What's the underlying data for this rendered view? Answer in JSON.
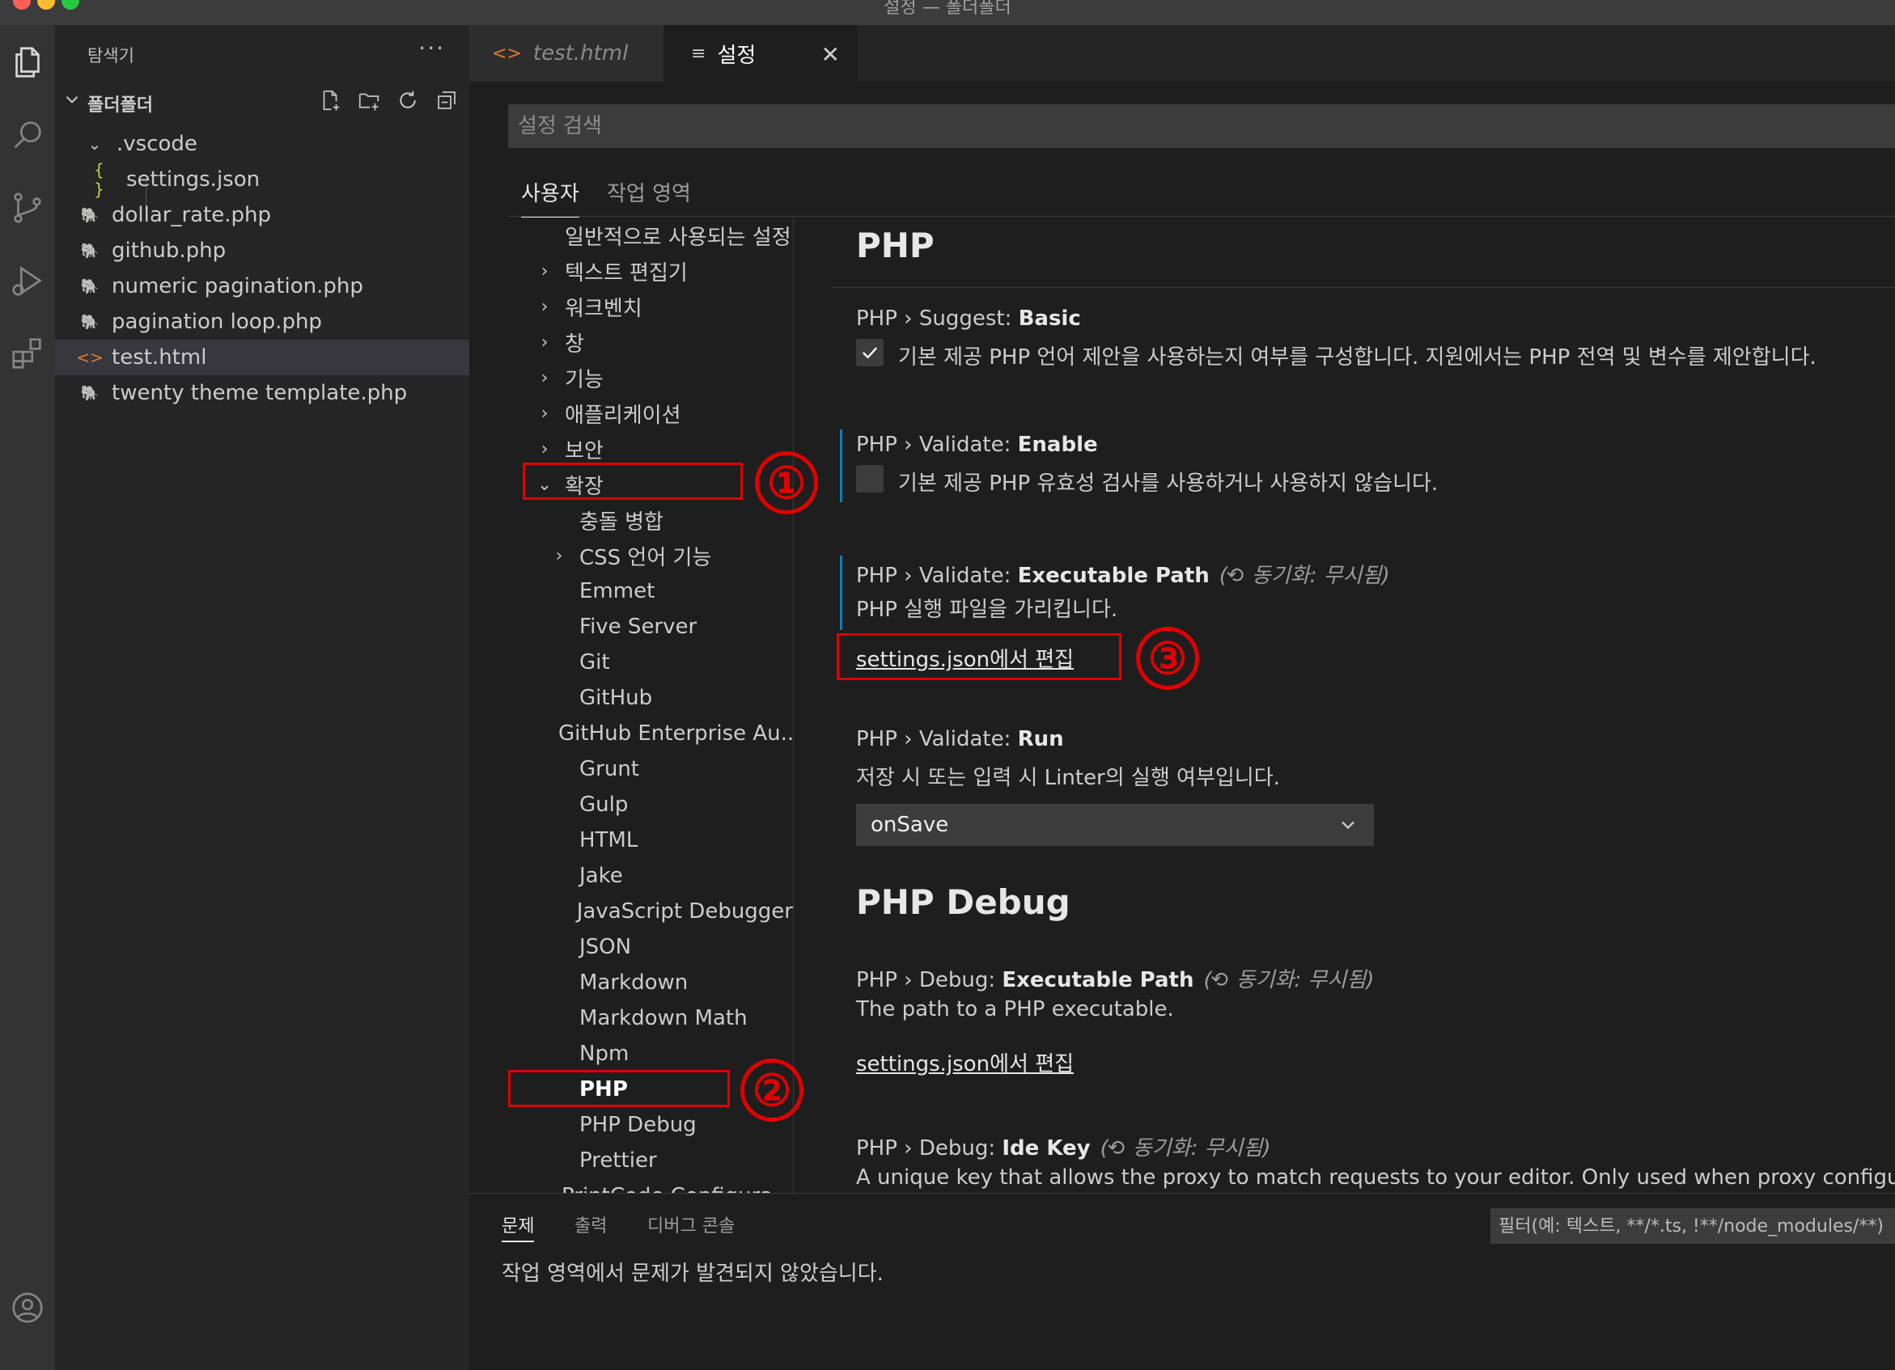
{
  "window": {
    "title": "설정 — 폴더폴더",
    "traffic_colors": [
      "#ff5f57",
      "#febc2e",
      "#28c840"
    ]
  },
  "activity_bar": {
    "icons": [
      "files-icon",
      "search-icon",
      "source-control-icon",
      "run-debug-icon",
      "extensions-icon",
      "account-icon"
    ]
  },
  "sidebar": {
    "header": "탐색기",
    "more": "···",
    "folder_name": "폴더폴더",
    "tree": [
      {
        "label": ".vscode",
        "type": "folder"
      },
      {
        "label": "settings.json",
        "type": "json",
        "icon": "{ }"
      },
      {
        "label": "dollar_rate.php",
        "type": "php"
      },
      {
        "label": "github.php",
        "type": "php"
      },
      {
        "label": "numeric pagination.php",
        "type": "php"
      },
      {
        "label": "pagination loop.php",
        "type": "php"
      },
      {
        "label": "test.html",
        "type": "html",
        "icon": "<>"
      },
      {
        "label": "twenty theme template.php",
        "type": "php"
      }
    ]
  },
  "tabs": [
    {
      "label": "test.html",
      "icon": "<>"
    },
    {
      "label": "설정",
      "icon": "≡",
      "close": "✕"
    }
  ],
  "settings": {
    "search_placeholder": "설정 검색",
    "scope_tabs": [
      "사용자",
      "작업 영역"
    ],
    "toc": [
      {
        "label": "일반적으로 사용되는 설정",
        "chev": ""
      },
      {
        "label": "텍스트 편집기",
        "chev": "›"
      },
      {
        "label": "워크벤치",
        "chev": "›"
      },
      {
        "label": "창",
        "chev": "›"
      },
      {
        "label": "기능",
        "chev": "›"
      },
      {
        "label": "애플리케이션",
        "chev": "›"
      },
      {
        "label": "보안",
        "chev": "›"
      },
      {
        "label": "확장",
        "chev": "⌄"
      },
      {
        "label": "충돌 병합",
        "chev": ""
      },
      {
        "label": "CSS 언어 기능",
        "chev": "›"
      },
      {
        "label": "Emmet",
        "chev": ""
      },
      {
        "label": "Five Server",
        "chev": ""
      },
      {
        "label": "Git",
        "chev": ""
      },
      {
        "label": "GitHub",
        "chev": ""
      },
      {
        "label": "GitHub Enterprise Au...",
        "chev": ""
      },
      {
        "label": "Grunt",
        "chev": ""
      },
      {
        "label": "Gulp",
        "chev": ""
      },
      {
        "label": "HTML",
        "chev": ""
      },
      {
        "label": "Jake",
        "chev": ""
      },
      {
        "label": "JavaScript Debugger",
        "chev": ""
      },
      {
        "label": "JSON",
        "chev": ""
      },
      {
        "label": "Markdown",
        "chev": ""
      },
      {
        "label": "Markdown Math",
        "chev": ""
      },
      {
        "label": "Npm",
        "chev": ""
      },
      {
        "label": "PHP",
        "chev": ""
      },
      {
        "label": "PHP Debug",
        "chev": ""
      },
      {
        "label": "Prettier",
        "chev": ""
      },
      {
        "label": "PrintCode Configura...",
        "chev": ""
      }
    ],
    "php_section": "PHP",
    "suggest_basic": {
      "prefix": "PHP › Suggest: ",
      "name": "Basic",
      "label": "기본 제공 PHP 언어 제안을 사용하는지 여부를 구성합니다. 지원에서는 PHP 전역 및 변수를 제안합니다.",
      "checked": true
    },
    "validate_enable": {
      "prefix": "PHP › Validate: ",
      "name": "Enable",
      "label": "기본 제공 PHP 유효성 검사를 사용하거나 사용하지 않습니다.",
      "checked": false
    },
    "validate_exec": {
      "prefix": "PHP › Validate: ",
      "name": "Executable Path",
      "sync": "(⟲ 동기화: 무시됨)",
      "desc": "PHP 실행 파일을 가리킵니다.",
      "link": "settings.json에서 편집"
    },
    "validate_run": {
      "prefix": "PHP › Validate: ",
      "name": "Run",
      "desc": "저장 시 또는 입력 시 Linter의 실행 여부입니다.",
      "value": "onSave"
    },
    "php_debug_section": "PHP Debug",
    "debug_exec": {
      "prefix": "PHP › Debug: ",
      "name": "Executable Path",
      "sync": "(⟲ 동기화: 무시됨)",
      "desc": "The path to a PHP executable.",
      "link": "settings.json에서 편집"
    },
    "debug_ide_key": {
      "prefix": "PHP › Debug: ",
      "name": "Ide Key",
      "sync": "(⟲ 동기화: 무시됨)",
      "desc": "A unique key that allows the proxy to match requests to your editor. Only used when proxy configuration in"
    }
  },
  "annotations": [
    "①",
    "②",
    "③"
  ],
  "panel": {
    "tabs": [
      "문제",
      "출력",
      "디버그 콘솔"
    ],
    "filter_placeholder": "필터(예: 텍스트, **/*.ts, !**/node_modules/**)",
    "message": "작업 영역에서 문제가 발견되지 않았습니다."
  }
}
